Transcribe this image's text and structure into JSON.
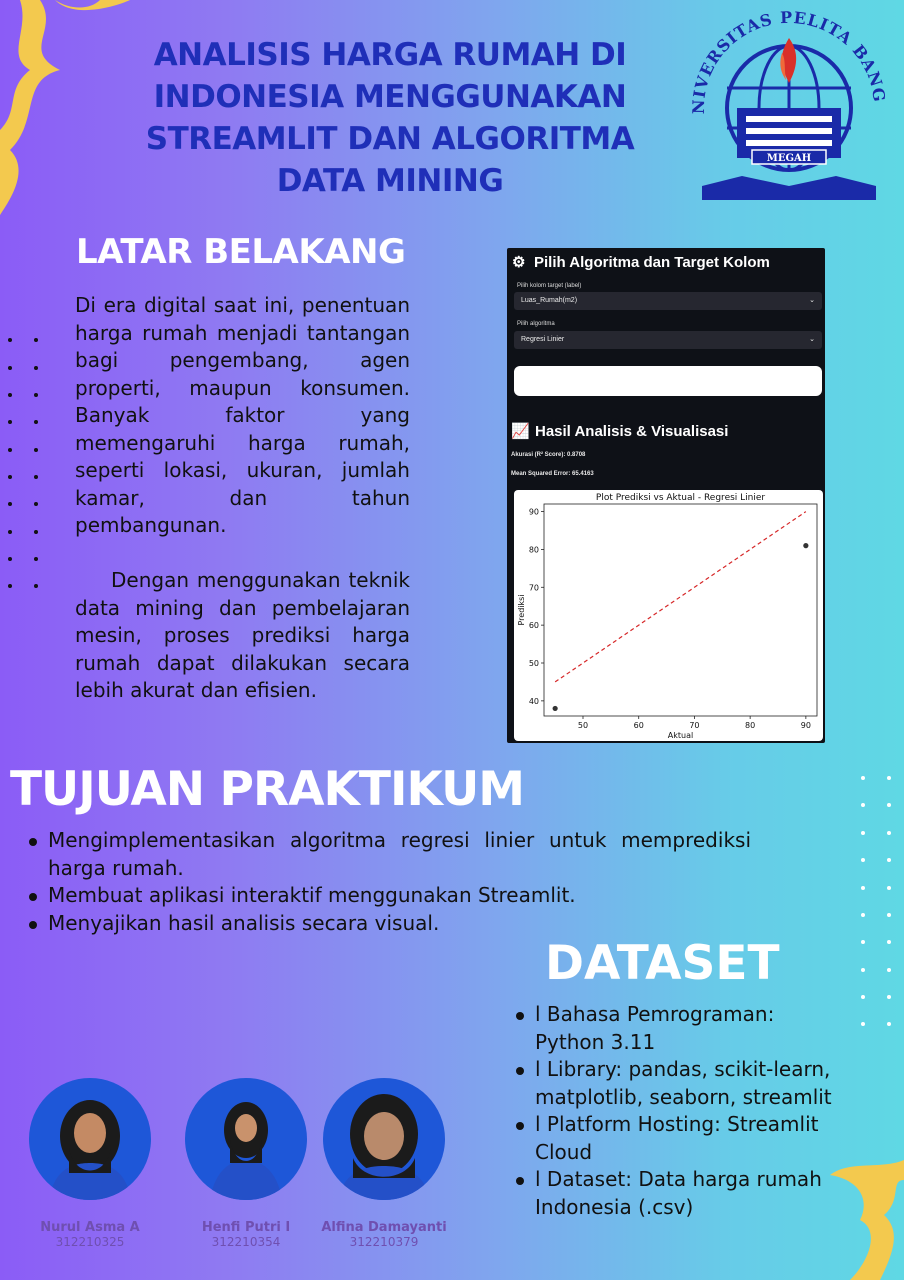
{
  "poster": {
    "title": "ANALISIS HARGA RUMAH DI INDONESIA MENGGUNAKAN STREAMLIT DAN ALGORITMA DATA MINING",
    "logo": {
      "ring_text": "UNIVERSITAS PELITA BANGSA",
      "banner": "MEGAH"
    },
    "accent_colors": {
      "title": "#1f2fb8",
      "swoosh": "#f3c94e",
      "logo": "#1a2aa8"
    }
  },
  "latar": {
    "heading": "LATAR BELAKANG",
    "p1": "Di era digital saat ini, penentuan harga rumah menjadi tantangan bagi pengembang, agen properti, maupun konsumen. Banyak faktor yang memengaruhi harga rumah, seperti lokasi, ukuran, jumlah kamar, dan tahun pembangunan.",
    "p2": "Dengan menggunakan teknik data mining dan pembelajaran mesin, proses prediksi harga rumah dapat dilakukan secara lebih akurat dan efisien."
  },
  "app": {
    "header1": "Pilih Algoritma dan Target Kolom",
    "target_label": "Pilih kolom target (label)",
    "target_value": "Luas_Rumah(m2)",
    "algo_label": "Pilih algoritma",
    "algo_value": "Regresi Linier",
    "header2": "Hasil Analisis & Visualisasi",
    "accuracy": "Akurasi (R² Score): 0.8708",
    "mse": "Mean Squared Error: 65.4163",
    "icons": [
      "gear-icon",
      "chart-icon"
    ]
  },
  "chart_data": {
    "type": "scatter",
    "title": "Plot Prediksi vs Aktual - Regresi Linier",
    "xlabel": "Aktual",
    "ylabel": "Prediksi",
    "xlim": [
      43,
      92
    ],
    "ylim": [
      36,
      92
    ],
    "xticks": [
      50,
      60,
      70,
      80,
      90
    ],
    "yticks": [
      40,
      50,
      60,
      70,
      80,
      90
    ],
    "points": [
      {
        "x": 45,
        "y": 38
      },
      {
        "x": 90,
        "y": 81
      }
    ],
    "reference_line": {
      "from": [
        45,
        45
      ],
      "to": [
        90,
        90
      ],
      "style": "dashed",
      "color": "#d62728"
    },
    "point_color": "#333333"
  },
  "tujuan": {
    "heading": "TUJUAN PRAKTIKUM",
    "items": [
      "Mengimplementasikan algoritma regresi linier untuk memprediksi harga rumah.",
      "Membuat aplikasi interaktif menggunakan Streamlit.",
      "Menyajikan hasil analisis secara visual."
    ]
  },
  "dataset": {
    "heading": "DATASET",
    "items": [
      "l Bahasa Pemrograman: Python 3.11",
      "l Library: pandas, scikit-learn, matplotlib, seaborn, streamlit",
      "l Platform Hosting: Streamlit Cloud",
      "l Dataset: Data harga rumah Indonesia (.csv)"
    ]
  },
  "team": [
    {
      "name": "Nurul Asma A",
      "nim": "312210325"
    },
    {
      "name": "Henfi Putri I",
      "nim": "312210354"
    },
    {
      "name": "Alfina Damayanti",
      "nim": "312210379"
    }
  ]
}
